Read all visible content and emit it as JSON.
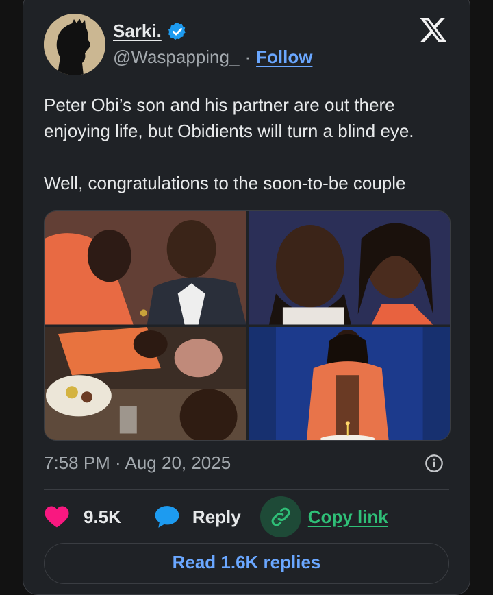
{
  "author": {
    "display_name": "Sarki.",
    "handle": "@Waspapping_",
    "separator": "·",
    "follow_label": "Follow",
    "verified": true
  },
  "tweet": {
    "paragraph_1": "Peter Obi’s son and his partner are out there enjoying life, but Obidients will turn a blind eye.",
    "paragraph_2": "Well, congratulations to the soon-to-be couple",
    "timestamp": "7:58 PM · Aug 20, 2025"
  },
  "media": {
    "count": 4
  },
  "actions": {
    "likes": "9.5K",
    "reply_label": "Reply",
    "copy_link_label": "Copy link",
    "read_replies_label": "Read 1.6K replies"
  },
  "icons": {
    "logo": "x-logo-icon",
    "verified": "verified-badge-icon",
    "info": "info-icon",
    "like": "heart-icon",
    "reply": "reply-bubble-icon",
    "copy": "link-icon"
  },
  "colors": {
    "card_bg": "#1f2226",
    "link_blue": "#6aa7ff",
    "heart": "#f91880",
    "reply_blue": "#1d9bf0",
    "copy_green": "#2fbf77"
  }
}
